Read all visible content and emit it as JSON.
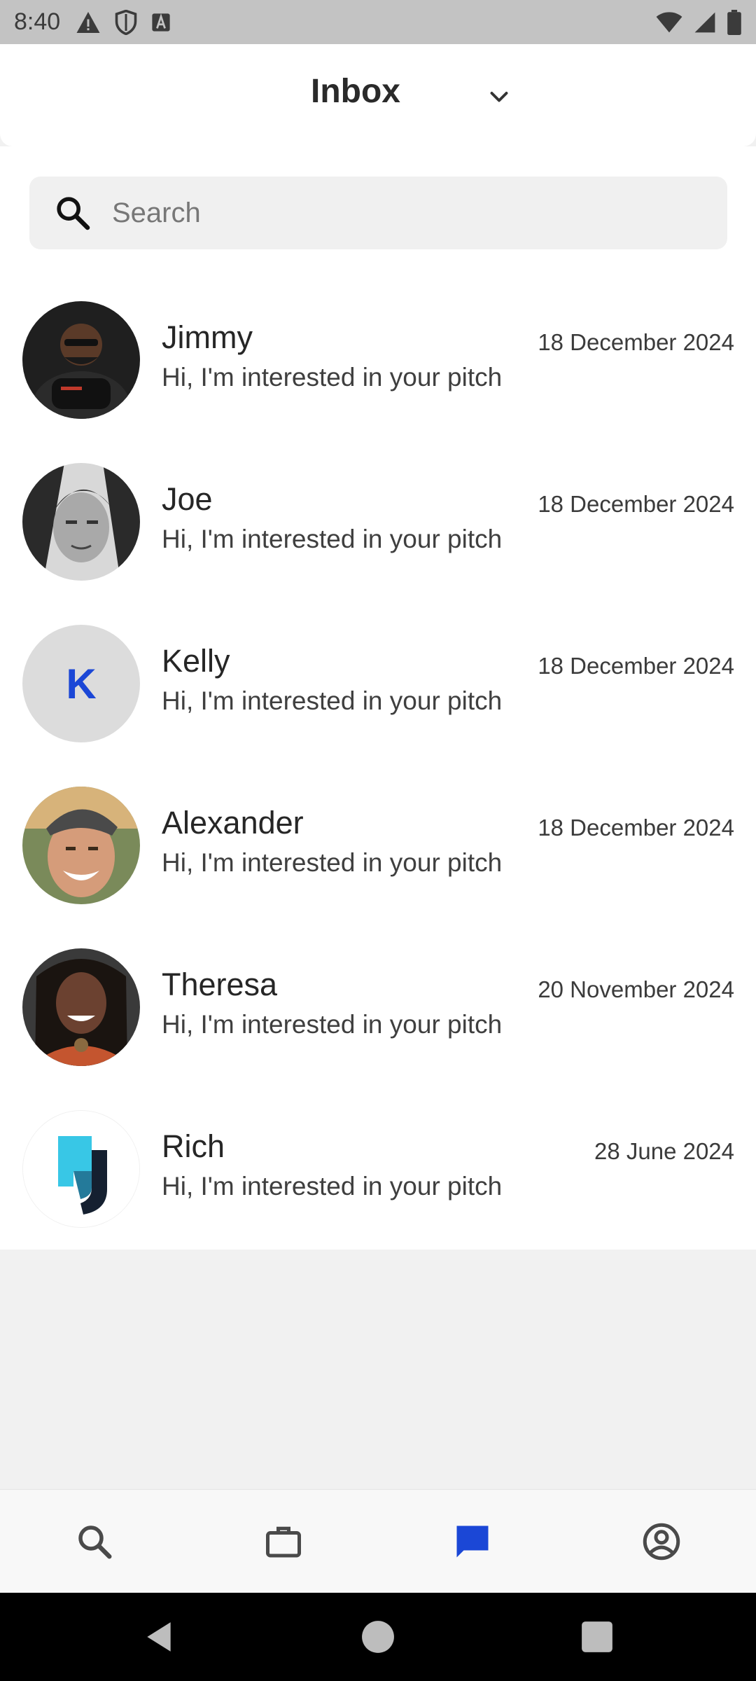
{
  "status_bar": {
    "time": "8:40",
    "icons_left": [
      "warning-icon",
      "shield-icon",
      "a-icon"
    ],
    "icons_right": [
      "wifi-icon",
      "signal-icon",
      "battery-icon"
    ]
  },
  "header": {
    "title": "Inbox",
    "dropdown_icon": "chevron-down-icon"
  },
  "search": {
    "placeholder": "Search",
    "value": ""
  },
  "conversations": [
    {
      "name": "Jimmy",
      "message": "Hi, I'm interested in your pitch",
      "date": "18 December 2024",
      "avatar": "photo"
    },
    {
      "name": "Joe",
      "message": "Hi, I'm interested in your pitch",
      "date": "18 December 2024",
      "avatar": "photo"
    },
    {
      "name": "Kelly",
      "message": "Hi, I'm interested in your pitch",
      "date": "18 December 2024",
      "avatar": "initial",
      "initial": "K"
    },
    {
      "name": "Alexander",
      "message": "Hi, I'm interested in your pitch",
      "date": "18 December 2024",
      "avatar": "photo"
    },
    {
      "name": "Theresa",
      "message": "Hi, I'm interested in your pitch",
      "date": "20 November 2024",
      "avatar": "photo"
    },
    {
      "name": "Rich",
      "message": "Hi, I'm interested in your pitch",
      "date": "28 June 2024",
      "avatar": "logo"
    }
  ],
  "bottom_nav": {
    "items": [
      "search-icon",
      "briefcase-icon",
      "chat-icon",
      "profile-icon"
    ],
    "active": "chat-icon"
  },
  "colors": {
    "accent": "#1b47d6",
    "initial_avatar_bg": "#dcdcdc"
  }
}
